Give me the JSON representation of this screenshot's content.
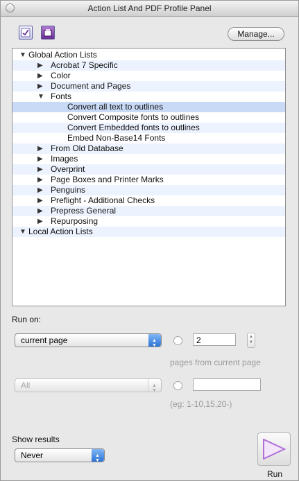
{
  "window": {
    "title": "Action List And PDF Profile Panel"
  },
  "toolbar": {
    "manage_label": "Manage..."
  },
  "tree": {
    "rows": [
      {
        "label": "Global Action Lists",
        "expanded": true,
        "selected": false
      },
      {
        "label": "Acrobat 7 Specific",
        "expanded": false,
        "selected": false
      },
      {
        "label": "Color",
        "expanded": false,
        "selected": false
      },
      {
        "label": "Document and Pages",
        "expanded": false,
        "selected": false
      },
      {
        "label": "Fonts",
        "expanded": true,
        "selected": false
      },
      {
        "label": "Convert all text to outlines",
        "selected": true
      },
      {
        "label": "Convert Composite fonts to outlines",
        "selected": false
      },
      {
        "label": "Convert Embedded fonts to outlines",
        "selected": false
      },
      {
        "label": "Embed Non-Base14 Fonts",
        "selected": false
      },
      {
        "label": "From Old Database",
        "expanded": false,
        "selected": false
      },
      {
        "label": "Images",
        "expanded": false,
        "selected": false
      },
      {
        "label": "Overprint",
        "expanded": false,
        "selected": false
      },
      {
        "label": "Page Boxes and Printer Marks",
        "expanded": false,
        "selected": false
      },
      {
        "label": "Penguins",
        "expanded": false,
        "selected": false
      },
      {
        "label": "Preflight - Additional Checks",
        "expanded": false,
        "selected": false
      },
      {
        "label": "Prepress General",
        "expanded": false,
        "selected": false
      },
      {
        "label": "Repurposing",
        "expanded": false,
        "selected": false
      },
      {
        "label": "Local Action Lists",
        "expanded": true,
        "selected": false
      }
    ]
  },
  "run_on": {
    "label": "Run on:",
    "page_select": "current page",
    "pages_count": "2",
    "pages_hint": "pages from current page",
    "range_select": "All",
    "range_value": "",
    "range_hint": "(eg: 1-10,15,20-)"
  },
  "show_results": {
    "label": "Show results",
    "value": "Never"
  },
  "run": {
    "label": "Run"
  },
  "colors": {
    "selection": "#c8daf6",
    "stripe": "#edf3fe",
    "accent": "#2f74d6",
    "run_icon": "#b06fd8"
  },
  "icons": [
    "close-icon",
    "action-list-icon",
    "pdf-profile-icon",
    "disclosure-triangle-icon",
    "popup-arrows-icon",
    "stepper-icon",
    "play-icon"
  ]
}
